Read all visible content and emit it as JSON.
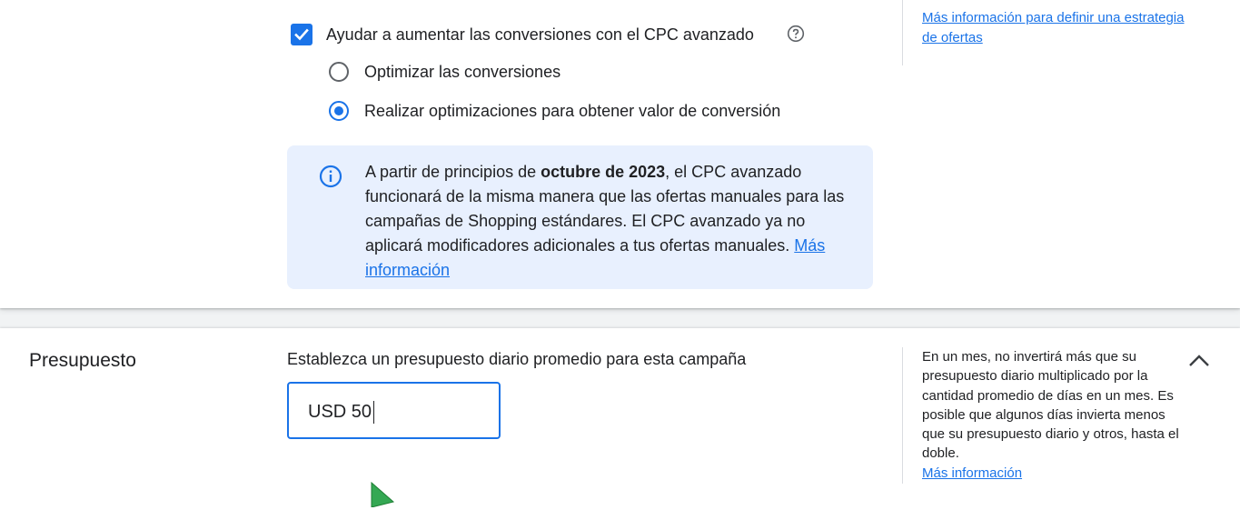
{
  "bidding": {
    "enhanced_cpc_label": "Ayudar a aumentar las conversiones con el CPC avanzado",
    "enhanced_cpc_checked": true,
    "options": [
      {
        "label": "Optimizar las conversiones",
        "selected": false
      },
      {
        "label": "Realizar optimizaciones para obtener valor de conversión",
        "selected": true
      }
    ],
    "notice": {
      "prefix": "A partir de principios de ",
      "bold": "octubre de 2023",
      "suffix": ", el CPC avanzado funcionará de la misma manera que las ofertas manuales para las campañas de Shopping estándares. El CPC avanzado ya no aplicará modificadores adicionales a tus ofertas manuales. ",
      "link": "Más información"
    },
    "side_link": "Más información para definir una estrategia de ofertas"
  },
  "budget": {
    "title": "Presupuesto",
    "description": "Establezca un presupuesto diario promedio para esta campaña",
    "input_value": "USD 50",
    "side_text": "En un mes, no invertirá más que su presupuesto diario multiplicado por la cantidad promedio de días en un mes. Es posible que algunos días invierta menos que su presupuesto diario y otros, hasta el doble.",
    "side_link": "Más información"
  },
  "colors": {
    "accent": "#1a73e8",
    "info_bg": "#e8f0fe",
    "cursor": "#34a853"
  },
  "icons": [
    "checkbox-checked-icon",
    "help-circle-icon",
    "info-icon",
    "chevron-up-icon",
    "mouse-cursor-icon"
  ]
}
